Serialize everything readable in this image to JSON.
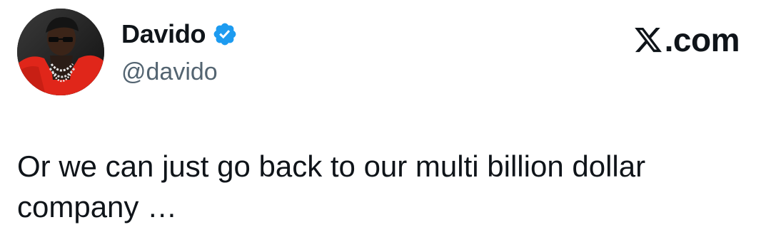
{
  "author": {
    "display_name": "Davido",
    "handle": "@davido",
    "verified": true,
    "avatar_icon": "profile-photo",
    "verified_icon": "verified-badge-icon",
    "verified_color": "#1d9bf0"
  },
  "source": {
    "label": ".com",
    "logo_icon": "x-logo-icon"
  },
  "tweet": {
    "text": "Or we can just go back to our multi billion dollar company …"
  },
  "colors": {
    "text": "#0f1419",
    "secondary": "#536471",
    "background": "#ffffff",
    "accent": "#1d9bf0"
  }
}
